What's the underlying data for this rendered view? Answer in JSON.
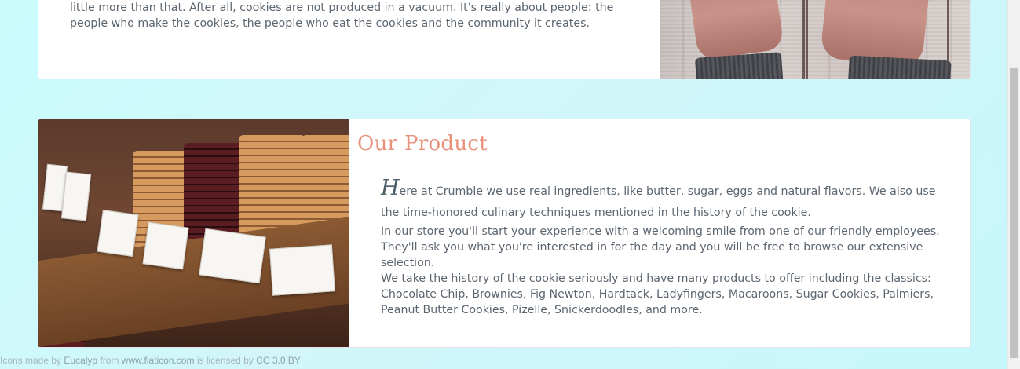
{
  "about": {
    "line1": "little more than that. After all, cookies are not produced in a vacuum. It's really about people: the",
    "line2": "people who make the cookies, the people who eat the cookies and the community it creates."
  },
  "product": {
    "title": "Our Product",
    "dropcap": "H",
    "paragraph1": "ere at Crumble we use real ingredients, like butter, sugar, eggs and natural flavors. We also use the time-honored culinary techniques mentioned in the history of the cookie.",
    "paragraph2": "In our store you'll start your experience with a welcoming smile from one of our friendly employees. They'll ask you what you're interested in for the day and you will be free to browse our extensive selection.",
    "paragraph3": "We take the history of the cookie seriously and have many products to offer including the classics: Chocolate Chip, Brownies, Fig Newton, Hardtack, Ladyfingers, Macaroons, Sugar Cookies, Palmiers, Peanut Butter Cookies, Pizelle, Snickerdoodles, and more."
  },
  "footer": {
    "prefix": "Icons made by",
    "author": "Eucalyp",
    "from": "from",
    "site": "www.flaticon.com",
    "licensed": "is licensed by",
    "license": "CC 3.0 BY"
  },
  "colors": {
    "accent": "#e8927c",
    "background": "#cdf8fa"
  }
}
